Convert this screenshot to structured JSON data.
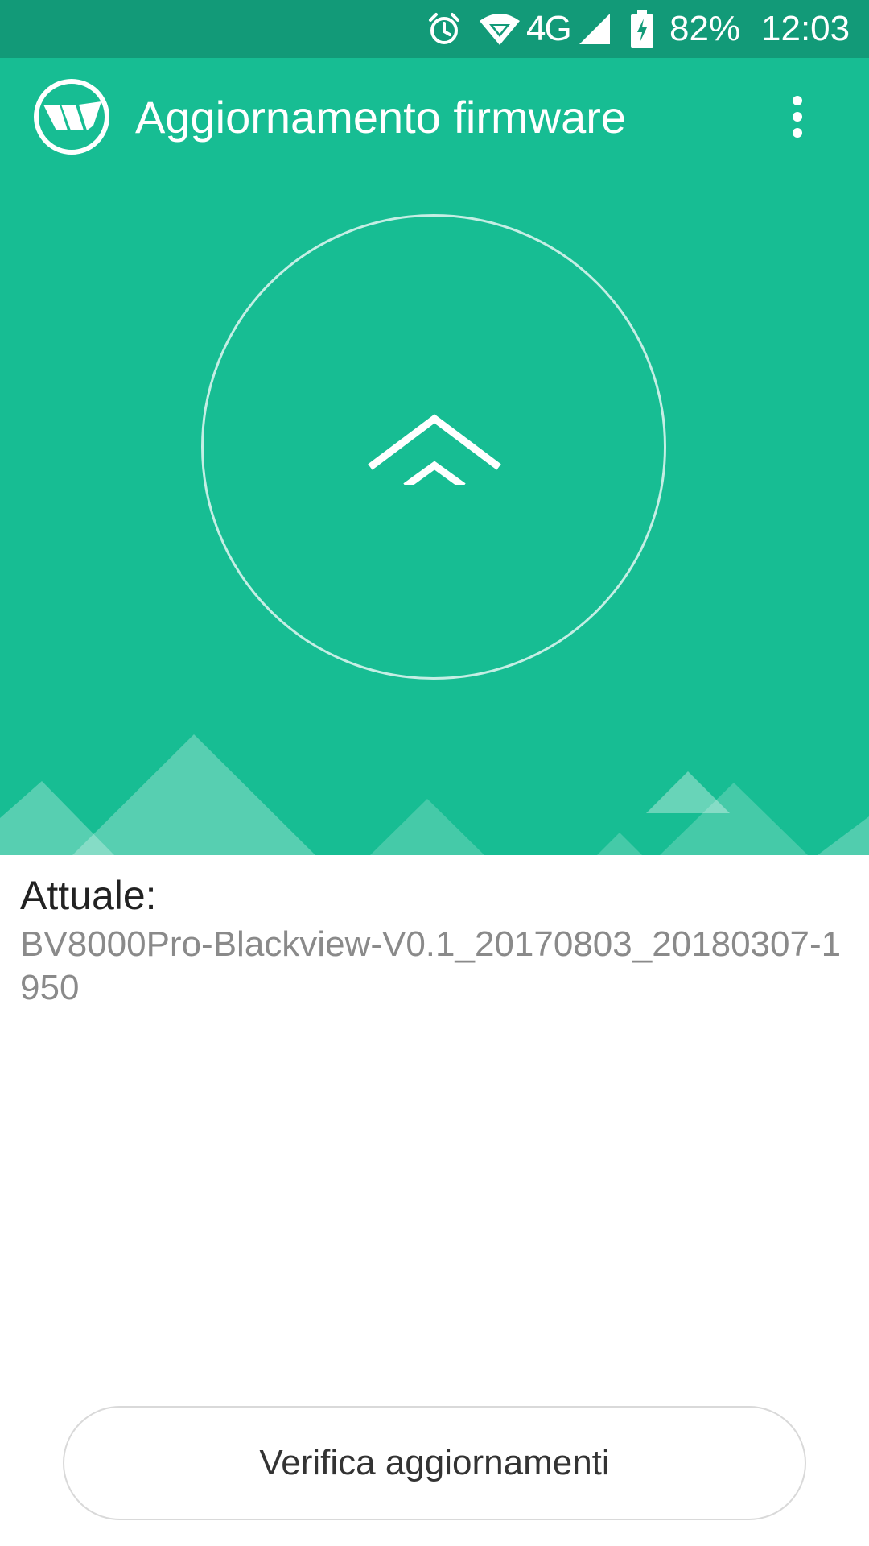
{
  "status_bar": {
    "network_type": "4G",
    "battery_percent": "82%",
    "time": "12:03",
    "icons": [
      "alarm-icon",
      "wifi-icon",
      "signal-icon",
      "battery-charging-icon"
    ]
  },
  "app_bar": {
    "title": "Aggiornamento firmware",
    "logo_icon": "wave-logo-icon",
    "overflow_icon": "more-vert-icon"
  },
  "hero": {
    "center_icon": "double-chevron-up-icon",
    "background_color": "#17bd93"
  },
  "firmware": {
    "label": "Attuale:",
    "version": "BV8000Pro-Blackview-V0.1_20170803_20180307-1950"
  },
  "actions": {
    "check_updates_label": "Verifica aggiornamenti"
  },
  "colors": {
    "status_bar": "#129a78",
    "accent": "#17bd93"
  }
}
